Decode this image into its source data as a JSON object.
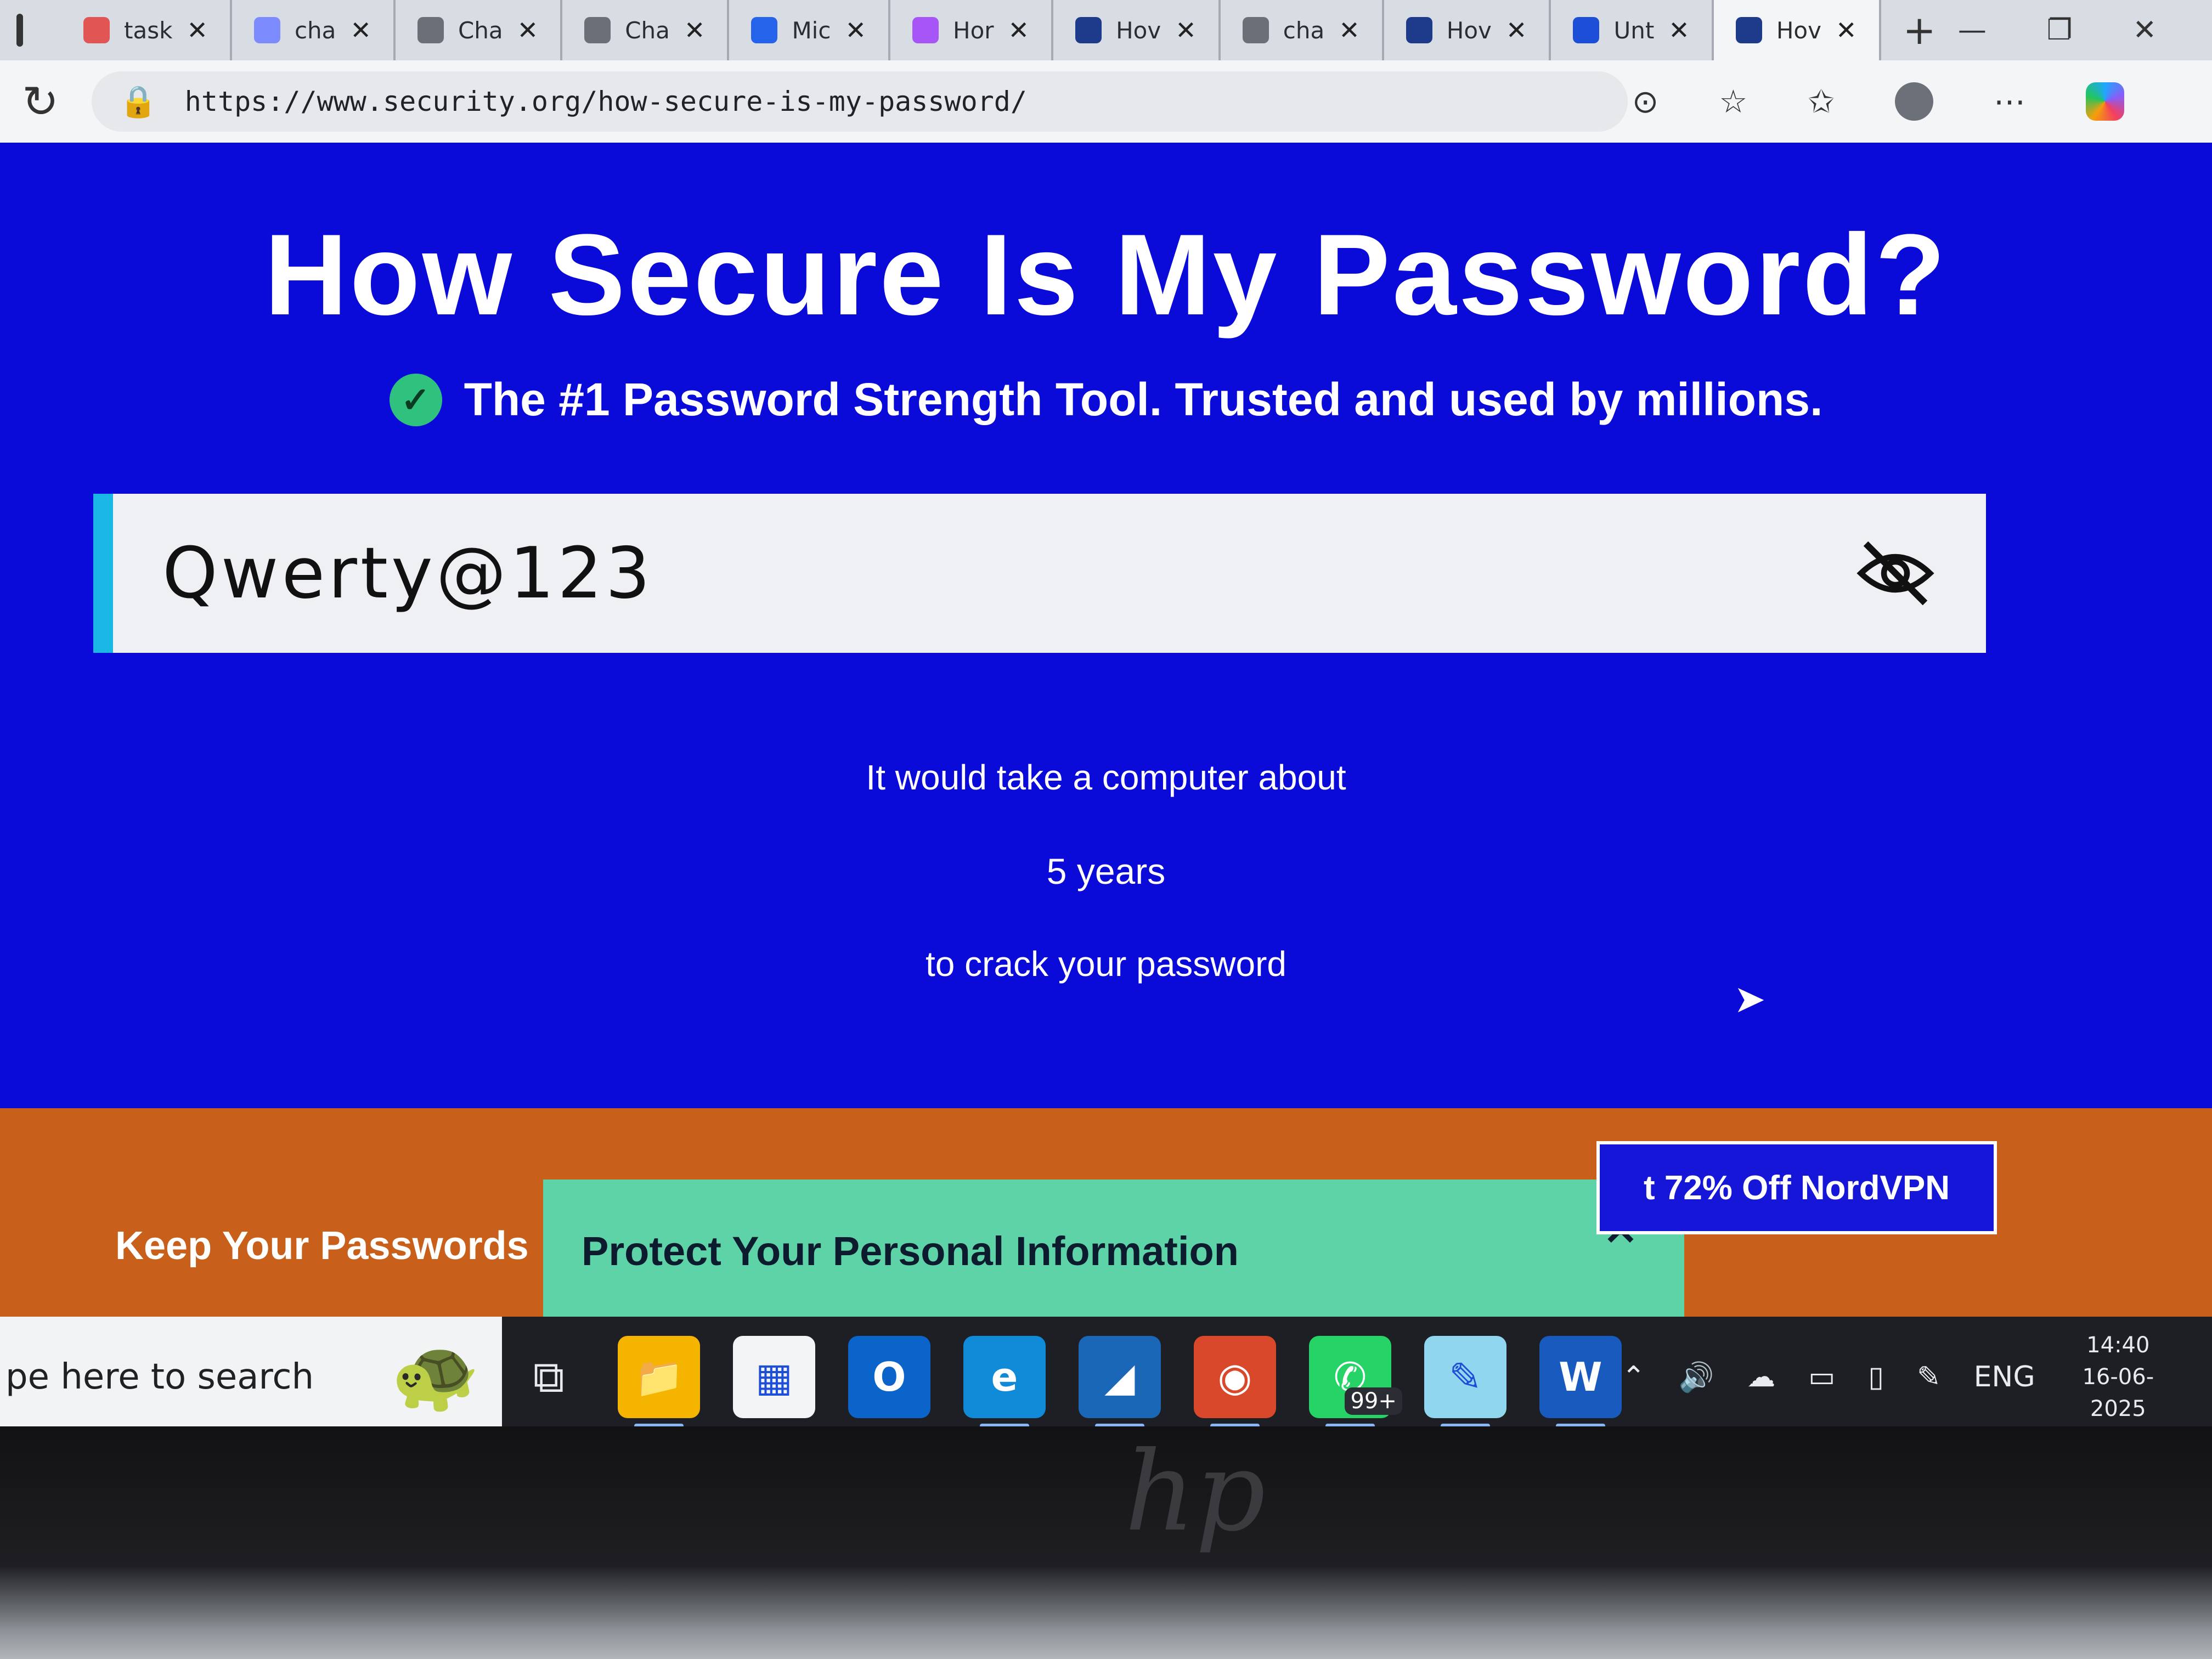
{
  "browser": {
    "tabs": [
      {
        "label": "task",
        "favicon": "pdf-icon",
        "color": "#e25555"
      },
      {
        "label": "cha",
        "favicon": "search-favicon",
        "color": "#7c8cff"
      },
      {
        "label": "Cha",
        "favicon": "chatgpt-icon",
        "color": "#6b6f78"
      },
      {
        "label": "Cha",
        "favicon": "chatgpt-icon",
        "color": "#6b6f78"
      },
      {
        "label": "Mic",
        "favicon": "microsoft-icon",
        "color": "#2563eb"
      },
      {
        "label": "Hor",
        "favicon": "copilot-icon",
        "color": "#a855f7"
      },
      {
        "label": "Hov",
        "favicon": "security-org-icon",
        "color": "#1e3a8a"
      },
      {
        "label": "cha",
        "favicon": "search-favicon",
        "color": "#6b6f78"
      },
      {
        "label": "Hov",
        "favicon": "security-org-icon",
        "color": "#1e3a8a"
      },
      {
        "label": "Unt",
        "favicon": "docs-icon",
        "color": "#1d4ed8"
      },
      {
        "label": "Hov",
        "favicon": "security-org-icon",
        "color": "#1e3a8a",
        "active": true
      }
    ],
    "new_tab_symbol": "+",
    "url": "https://www.security.org/how-secure-is-my-password/"
  },
  "page": {
    "title": "How Secure Is My Password?",
    "subtitle": "The #1 Password Strength Tool. Trusted and used by millions.",
    "password_value": "Qwerty@123",
    "result_prefix": "It would take a computer about",
    "result_time": "5 years",
    "result_suffix": "to crack your password"
  },
  "promo": {
    "left_heading": "Keep Your Passwords",
    "panel_title": "Protect Your Personal Information",
    "nordvpn_label": "t 72% Off NordVPN"
  },
  "taskbar": {
    "search_placeholder": "pe here to search",
    "apps": [
      {
        "name": "file-explorer",
        "glyph": "📁",
        "bg": "#f5b400",
        "running": true
      },
      {
        "name": "microsoft-store",
        "glyph": "▦",
        "bg": "#f3f4f6",
        "running": false
      },
      {
        "name": "outlook",
        "glyph": "O",
        "bg": "#0a64c9",
        "running": false
      },
      {
        "name": "edge",
        "glyph": "e",
        "bg": "#0f8bd8",
        "running": true
      },
      {
        "name": "wireshark",
        "glyph": "◢",
        "bg": "#1a67b8",
        "running": true
      },
      {
        "name": "chrome",
        "glyph": "◉",
        "bg": "#d9482b",
        "running": true
      },
      {
        "name": "whatsapp",
        "glyph": "✆",
        "bg": "#25d366",
        "running": true,
        "badge": "99+"
      },
      {
        "name": "notepad",
        "glyph": "✎",
        "bg": "#8fd6ee",
        "running": true
      },
      {
        "name": "word",
        "glyph": "W",
        "bg": "#185abd",
        "running": true
      }
    ],
    "language": "ENG",
    "time": "14:40",
    "date": "16-06-2025"
  },
  "colors": {
    "page_bg": "#0a0ad9",
    "accent_cyan": "#19b6e6",
    "promo_orange": "#c8601c",
    "promo_green": "#5fd3a8",
    "verified_green": "#2ec27e"
  }
}
